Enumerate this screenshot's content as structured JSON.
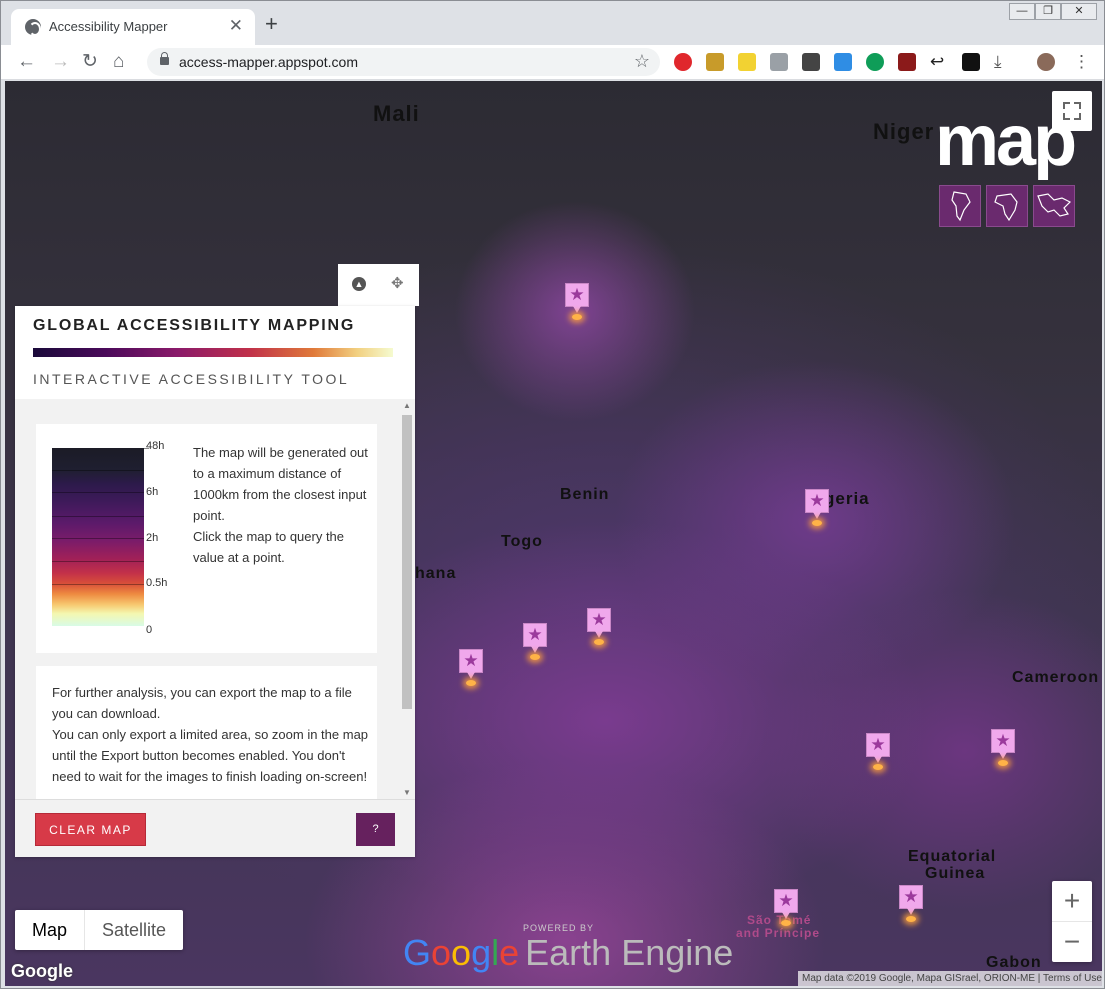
{
  "browser": {
    "tab_title": "Accessibility Mapper",
    "tab_close": "✕",
    "new_tab": "+",
    "url": "access-mapper.appspot.com",
    "window_controls": [
      "—",
      "❐",
      "✕"
    ]
  },
  "map": {
    "country_labels": [
      {
        "text": "Mali",
        "id": "mali"
      },
      {
        "text": "Niger",
        "id": "niger"
      },
      {
        "text": "Benin",
        "id": "benin"
      },
      {
        "text": "Togo",
        "id": "togo"
      },
      {
        "text": "Nigeria",
        "id": "nigeria"
      },
      {
        "text": "hana",
        "id": "ghana"
      },
      {
        "text": "Cameroon",
        "id": "cameroon"
      },
      {
        "text": "Equatorial",
        "id": "eq1"
      },
      {
        "text": "Guinea",
        "id": "eq2"
      },
      {
        "text": "Gabon",
        "id": "gabon"
      },
      {
        "text": "São Tomé",
        "id": "st1"
      },
      {
        "text": "and Príncipe",
        "id": "st2"
      }
    ],
    "brand": "map",
    "map_type": {
      "map": "Map",
      "satellite": "Satellite"
    },
    "zoom": {
      "in": "+",
      "out": "−"
    },
    "google_logo": "Google",
    "powered_by": "POWERED BY",
    "earth_engine": {
      "g1": "G",
      "g2": "o",
      "g3": "o",
      "g4": "g",
      "g5": "l",
      "g6": "e",
      "ee": "Earth Engine"
    },
    "attribution": "Map data ©2019 Google, Mapa GISrael, ORION-ME   |   Terms of Use"
  },
  "panel": {
    "title": "GLOBAL ACCESSIBILITY MAPPING",
    "subtitle": "INTERACTIVE ACCESSIBILITY TOOL",
    "legend_ticks": [
      "48h",
      "6h",
      "2h",
      "0.5h",
      "0"
    ],
    "description": "The map will be generated out to a maximum distance of 1000km from the closest input point.\nClick the map to query the value at a point.",
    "export_text": "For further analysis, you can export the map to a file you can download.\nYou can only export a limited area, so zoom in the map until the Export button becomes enabled. You don't need to wait for the images to finish loading on-screen!",
    "clear_button": "CLEAR MAP",
    "help_button": "?"
  },
  "colors": {
    "accent_red": "#d73a48",
    "accent_purple": "#66215e",
    "pin": "#f0a8ec"
  }
}
